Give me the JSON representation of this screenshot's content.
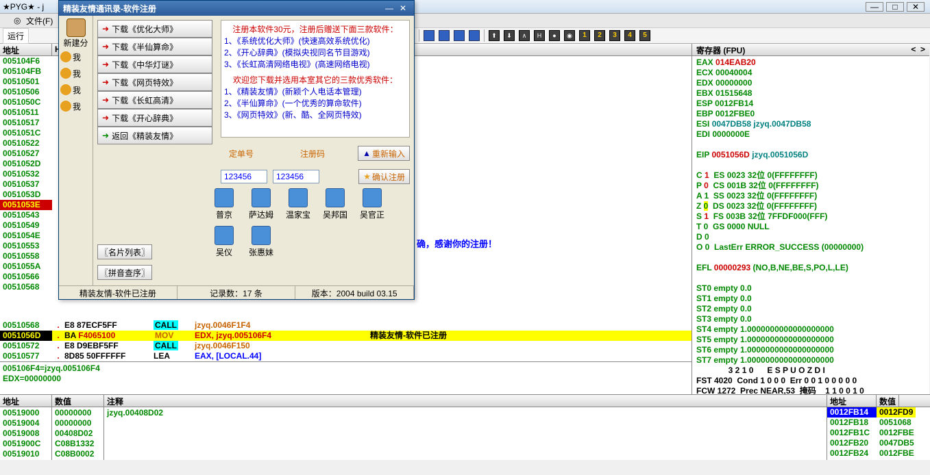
{
  "main_window": {
    "title": "★PYG★ - j"
  },
  "menu": {
    "file": "文件(F)",
    "run_label": "运行"
  },
  "win_buttons": {
    "min": "—",
    "max": "□",
    "close": "✕"
  },
  "addr_header": {
    "addr": "地址",
    "h": "H"
  },
  "addresses": [
    "005104F6",
    "005104FB",
    "00510501",
    "00510506",
    "0051050C",
    "00510511",
    "00510517",
    "0051051C",
    "00510522",
    "00510527",
    "0051052D",
    "00510532",
    "00510537",
    "0051053D",
    "0051053E",
    "00510543",
    "00510549",
    "0051054E",
    "00510553",
    "00510558",
    "0051055A",
    "00510566",
    "00510568"
  ],
  "disasm": [
    {
      "addr": "00510568",
      "dot": ".",
      "hex": "E8 87ECF5FF",
      "mnem": "CALL",
      "ops": "jzyq.0046F1F4",
      "mnem_style": "cyan",
      "ops_style": "orange"
    },
    {
      "addr": "0051056D",
      "dot": ".",
      "hex": "BA F4065100",
      "mnem": "MOV",
      "ops": "EDX, jzyq.005106F4",
      "mnem_style": "yellow",
      "ops_style": "red",
      "sel": true,
      "trail": "精装友情-软件已注册"
    },
    {
      "addr": "00510572",
      "dot": ".",
      "hex": "E8 D9EBF5FF",
      "mnem": "CALL",
      "ops": "jzyq.0046F150",
      "mnem_style": "cyan",
      "ops_style": "orange"
    },
    {
      "addr": "00510577",
      "dot": ".",
      "hex": "8D85 50FFFFFF",
      "mnem": "LEA",
      "ops": "EAX, [LOCAL.44]",
      "mnem_style": "",
      "ops_style": "blue"
    }
  ],
  "info": {
    "l1": "005106F4=jzyq.005106F4",
    "l2": "EDX=00000000"
  },
  "reg_header": "寄存器 (FPU)",
  "regs": [
    [
      "EAX ",
      "014EAB20",
      "red"
    ],
    [
      "ECX ",
      "00040004",
      ""
    ],
    [
      "EDX ",
      "00000000",
      ""
    ],
    [
      "EBX ",
      "01515648",
      ""
    ],
    [
      "ESP ",
      "0012FB14",
      ""
    ],
    [
      "EBP ",
      "0012FBE0",
      ""
    ],
    [
      "ESI ",
      "0047DB58 jzyq.0047DB58",
      "teal"
    ],
    [
      "EDI ",
      "0000000E",
      ""
    ]
  ],
  "eip": {
    "label": "EIP ",
    "val": "0051056D",
    "txt": " jzyq.0051056D"
  },
  "flags": [
    "C 1  ES 0023 32位 0(FFFFFFFF)",
    "P 0  CS 001B 32位 0(FFFFFFFF)",
    "A 1  SS 0023 32位 0(FFFFFFFF)",
    "Z 0  DS 0023 32位 0(FFFFFFFF)",
    "S 1  FS 003B 32位 7FFDF000(FFF)",
    "T 0  GS 0000 NULL",
    "D 0",
    "O 0  LastErr ERROR_SUCCESS (00000000)"
  ],
  "flag_styles": [
    "red",
    "red",
    "",
    "hlz",
    "red",
    "",
    "",
    ""
  ],
  "efl": "EFL 00000293 (NO,B,NE,BE,S,PO,L,LE)",
  "fpu": [
    "ST0 empty 0.0",
    "ST1 empty 0.0",
    "ST2 empty 0.0",
    "ST3 empty 0.0",
    "ST4 empty 1.0000000000000000000",
    "ST5 empty 1.0000000000000000000",
    "ST6 empty 1.0000000000000000000",
    "ST7 empty 1.0000000000000000000"
  ],
  "fpu_tail": [
    "              3 2 1 0      E S P U O Z D I",
    "FST 4020  Cond 1 0 0 0  Err 0 0 1 0 0 0 0 0",
    "FCW 1272  Prec NEAR,53  掩码    1 1 0 0 1 0"
  ],
  "dump_header": {
    "addr": "地址",
    "val": "数值",
    "comment": "注释"
  },
  "dump": [
    {
      "a": "00519000",
      "v": "00000000",
      "c": ""
    },
    {
      "a": "00519004",
      "v": "00000000",
      "c": ""
    },
    {
      "a": "00519008",
      "v": "00408D02",
      "c": "jzyq.00408D02"
    },
    {
      "a": "0051900C",
      "v": "C08B1332",
      "c": ""
    },
    {
      "a": "00519010",
      "v": "C08B0002",
      "c": ""
    }
  ],
  "stack_header": {
    "addr": "地址",
    "val": "数值"
  },
  "stack": [
    {
      "a": "0012FB14",
      "v": "0012FD9",
      "hl": true
    },
    {
      "a": "0012FB18",
      "v": "0051068"
    },
    {
      "a": "0012FB1C",
      "v": "0012FBE"
    },
    {
      "a": "0012FB20",
      "v": "0047DB5"
    },
    {
      "a": "0012FB24",
      "v": "0012FBE"
    }
  ],
  "app": {
    "title": "精装友情通讯录-软件注册",
    "left_tool": "新建分",
    "left_items": [
      "我",
      "我",
      "我",
      "我"
    ],
    "buttons": [
      "下载《优化大师》",
      "下载《半仙算命》",
      "下载《中华灯谜》",
      "下载《网页特效》",
      "下载《长虹高清》",
      "下载《开心辞典》",
      "返回《精装友情》"
    ],
    "promo_hdr": "注册本软件30元，注册后赠送下面三款软件：",
    "promo1": [
      "1、《系统优化大师》(快速高效系统优化)",
      "2、《开心辞典》(模拟央视同名节目游戏)",
      "3、《长虹高清网络电视》(高速网络电视)"
    ],
    "promo_mid": "欢迎您下载并选用本室其它的三款优秀软件：",
    "promo2": [
      "1、《精装友情》(新颖个人电话本管理)",
      "2、《半仙算命》(一个优秀的算命软件)",
      "3、《网页特效》(新、酷、全网页特效)"
    ],
    "order_label": "定单号",
    "reg_label": "注册码",
    "order_val": "123456",
    "reg_val": "123456",
    "btn_reinput": "重新输入",
    "btn_confirm": "确认注册",
    "btn_list": "〖名片列表〗",
    "btn_pinyin": "〖拼音查序〗",
    "icons": [
      "普京",
      "萨达姆",
      "温家宝",
      "吴邦国",
      "吴官正",
      "吴仪",
      "张惠妹"
    ],
    "status1": "精装友情-软件已注册",
    "status2": "记录数：17 条",
    "status3": "版本：2004 build 03.15",
    "msg": "确，感谢你的注册！"
  }
}
